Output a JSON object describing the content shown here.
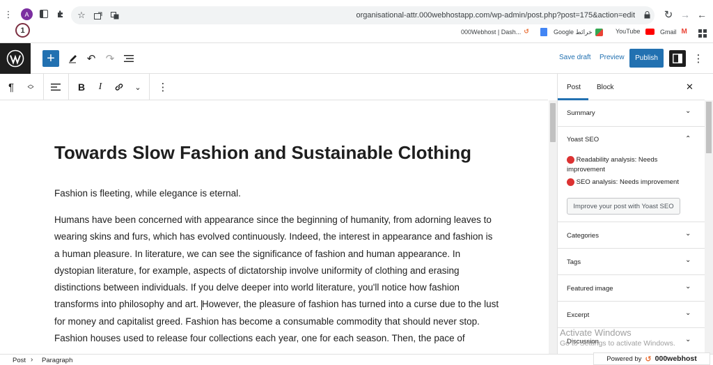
{
  "browser": {
    "avatar_letter": "A",
    "url": "organisational-attr.000webhostapp.com/wp-admin/post.php?post=175&action=edit",
    "badge_number": "1",
    "bookmarks": [
      {
        "label": "000Webhost | Dash...",
        "icon": "webhost-icon"
      },
      {
        "label": "",
        "icon": "adblock-icon"
      },
      {
        "label": "Google خرائط",
        "icon": "google-docs-icon"
      },
      {
        "label": "",
        "icon": "maps-icon"
      },
      {
        "label": "YouTube",
        "icon": "youtube-icon"
      },
      {
        "label": "Gmail",
        "icon": "gmail-icon"
      }
    ],
    "colors": {
      "avatar": "#7b2ea0",
      "youtube": "#ff0000"
    }
  },
  "wp_toolbar": {
    "save_draft": "Save draft",
    "preview": "Preview",
    "publish": "Publish",
    "accent": "#2271b1"
  },
  "editor": {
    "title": "Towards Slow Fashion and Sustainable Clothing",
    "paragraph1": "Fashion is fleeting, while elegance is eternal.",
    "paragraph2_part1": "Humans have been concerned with appearance since the beginning of humanity, from adorning leaves to wearing skins and furs, which has evolved continuously. Indeed, the interest in appearance and fashion is a human pleasure. In literature, we can see the significance of fashion and human appearance. In dystopian literature, for example, aspects of dictatorship involve uniformity of clothing and erasing distinctions between individuals. If you delve deeper into world literature, you'll notice how fashion transforms into philosophy and art. ",
    "paragraph2_part2": "However, the pleasure of fashion has turned into a curse due to the lust for money and capitalist greed. Fashion has become a consumable commodity that should never stop. Fashion houses used to release four collections each year, one for each season. Then, the pace of"
  },
  "sidebar": {
    "tabs": [
      "Post",
      "Block"
    ],
    "panels": {
      "summary": "Summary",
      "yoast": "Yoast SEO",
      "readability_label": "Readability analysis:",
      "readability_value": "Needs improvement",
      "seo_label": "SEO analysis:",
      "seo_value": "Needs improvement",
      "improve_button": "Improve your post with Yoast SEO",
      "categories": "Categories",
      "tags": "Tags",
      "featured_image": "Featured image",
      "excerpt": "Excerpt",
      "discussion": "Discussion"
    }
  },
  "statusbar": {
    "crumb1": "Post",
    "crumb2": "Paragraph",
    "powered_by": "Powered by",
    "brand": "000webhost"
  },
  "watermark": {
    "line1": "Activate Windows",
    "line2": "Go to Settings to activate Windows."
  }
}
